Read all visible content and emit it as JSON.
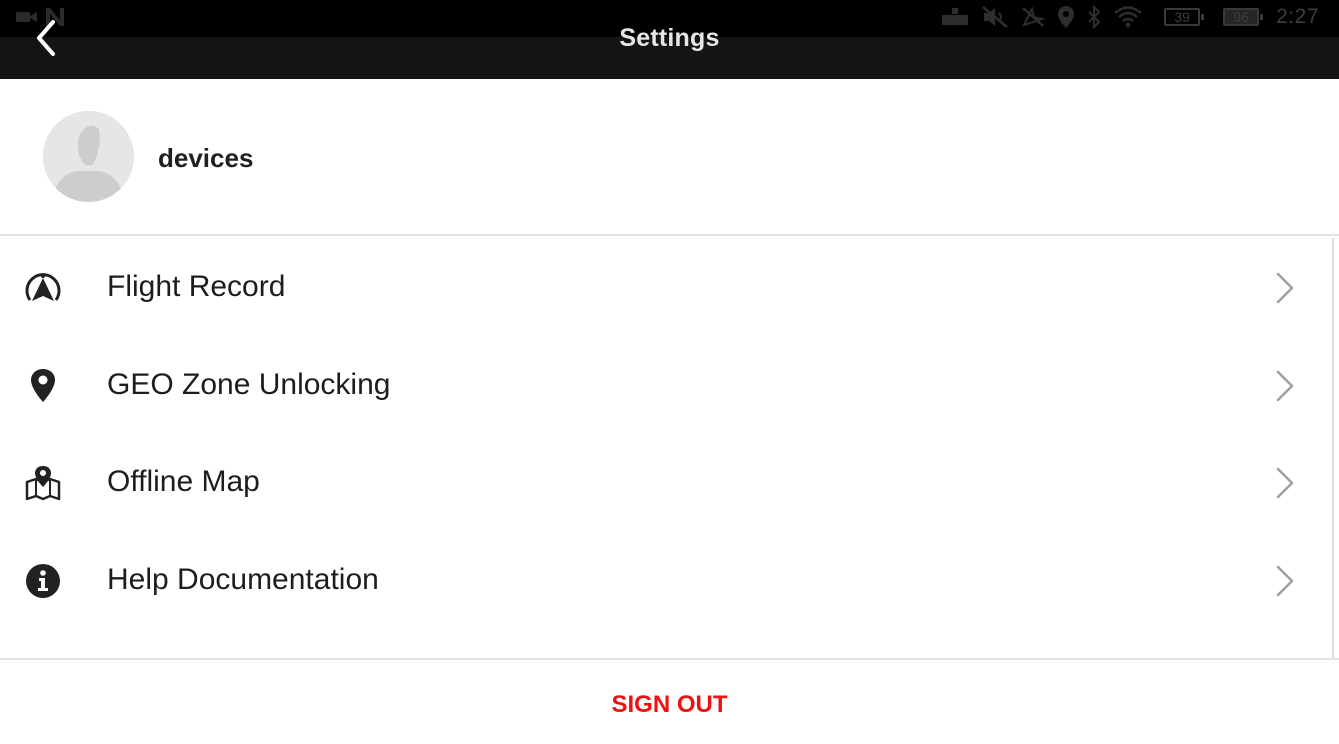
{
  "status_bar": {
    "left_icons": [
      "video-camera-icon",
      "n-notification-icon"
    ],
    "right_icons": [
      "keyboard-icon",
      "mute-icon",
      "no-gps-icon",
      "location-pin-icon",
      "bluetooth-icon",
      "wifi-icon"
    ],
    "remote_battery": "39",
    "device_battery": "96",
    "time": "2:27"
  },
  "header": {
    "title": "Settings",
    "back_icon": "chevron-left-icon"
  },
  "profile": {
    "avatar_icon": "person-placeholder-icon",
    "name": "devices"
  },
  "menu": {
    "items": [
      {
        "icon": "flight-record-icon",
        "label": "Flight Record",
        "chevron": "chevron-right-icon"
      },
      {
        "icon": "location-pin-icon",
        "label": "GEO Zone Unlocking",
        "chevron": "chevron-right-icon"
      },
      {
        "icon": "offline-map-icon",
        "label": "Offline Map",
        "chevron": "chevron-right-icon"
      },
      {
        "icon": "info-icon",
        "label": "Help Documentation",
        "chevron": "chevron-right-icon"
      }
    ]
  },
  "footer": {
    "sign_out_label": "SIGN OUT"
  },
  "colors": {
    "top_bar": "#141414",
    "status_strip": "#000000",
    "text_primary": "#1d1d1d",
    "chevron": "#9e9e9e",
    "divider": "#e3e3e3",
    "sign_out": "#ee1111"
  }
}
